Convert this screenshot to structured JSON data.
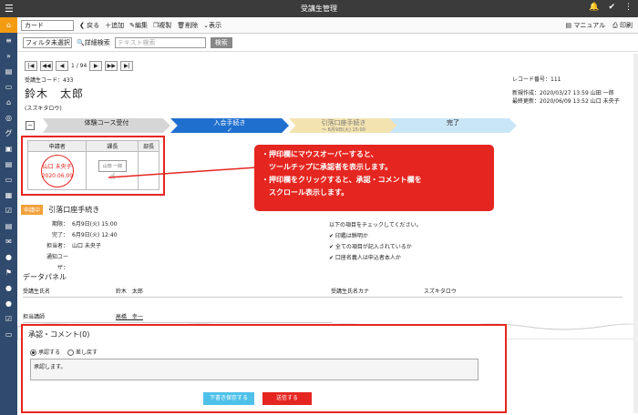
{
  "header": {
    "title": "受講生管理"
  },
  "toolbar": {
    "card_select": "カード",
    "back": "戻る",
    "add": "追加",
    "edit": "編集",
    "copy": "複製",
    "delete": "削除",
    "view": "表示",
    "manual": "マニュアル",
    "print": "印刷"
  },
  "filter": {
    "select": "フィルタ未選択",
    "advanced": "詳細検索",
    "placeholder": "テキスト検索",
    "search_btn": "検索"
  },
  "pager": {
    "text": "1 / 94"
  },
  "record": {
    "code": "受講生コード：433",
    "name": "鈴木　太郎",
    "kana": "(スズキタロウ)",
    "record_no": "レコード番号：111",
    "created": "新規作成：2020/03/27 13:59 山田 一郎",
    "updated": "最終更新：2020/06/09 13:52 山口 未央子"
  },
  "steps": [
    {
      "label": "体験コース受付",
      "sub": "",
      "color": "#d6d6d6"
    },
    {
      "label": "入会手続き",
      "sub": "✓",
      "color": "#1f6fcf"
    },
    {
      "label": "引落口座手続き",
      "sub": "〜 6月9日(火) 15:00",
      "color": "#f3e3b0"
    },
    {
      "label": "完了",
      "sub": "",
      "color": "#c9e6f7"
    }
  ],
  "stamps": {
    "headers": [
      "申請者",
      "課長",
      "部長"
    ],
    "applicant_name": "山口 未央子",
    "applicant_date": "2020.06.09",
    "manager_name": "山田 一郎"
  },
  "callout": {
    "line1": "・押印欄にマウスオーバーすると、",
    "line2": "　ツールチップに承認者を表示します。",
    "line3": "・押印欄をクリックすると、承認・コメント欄を",
    "line4": "　スクロール表示します。"
  },
  "request": {
    "tag": "申請中",
    "title": "引落口座手続き",
    "rows": [
      {
        "k": "期限：",
        "v": "6月9日(火) 15:00"
      },
      {
        "k": "完了：",
        "v": "6月9日(火) 12:40"
      },
      {
        "k": "担当者：",
        "v": "山口 未央子"
      },
      {
        "k": "通知ユーザ：",
        "v": ""
      }
    ],
    "check_intro": "以下の項目をチェックしてください。",
    "checks": [
      "✔ 印鑑は鮮明か",
      "✔ 全ての項目が記入されているか",
      "✔ 口座名義人は申込者本人か"
    ]
  },
  "datapanel": {
    "title": "データパネル",
    "f1_label": "受講生氏名",
    "f1_value": "鈴木　太郎",
    "f2_label": "受講生氏名カナ",
    "f2_value": "スズキタロウ",
    "f3_label": "担当講師",
    "f3_value": "高橋　幸一"
  },
  "approval": {
    "title": "承認・コメント(0)",
    "approve": "承認する",
    "reject": "差し戻す",
    "comment": "承認します。",
    "draft_btn": "下書き保存する",
    "send_btn": "送信する"
  }
}
